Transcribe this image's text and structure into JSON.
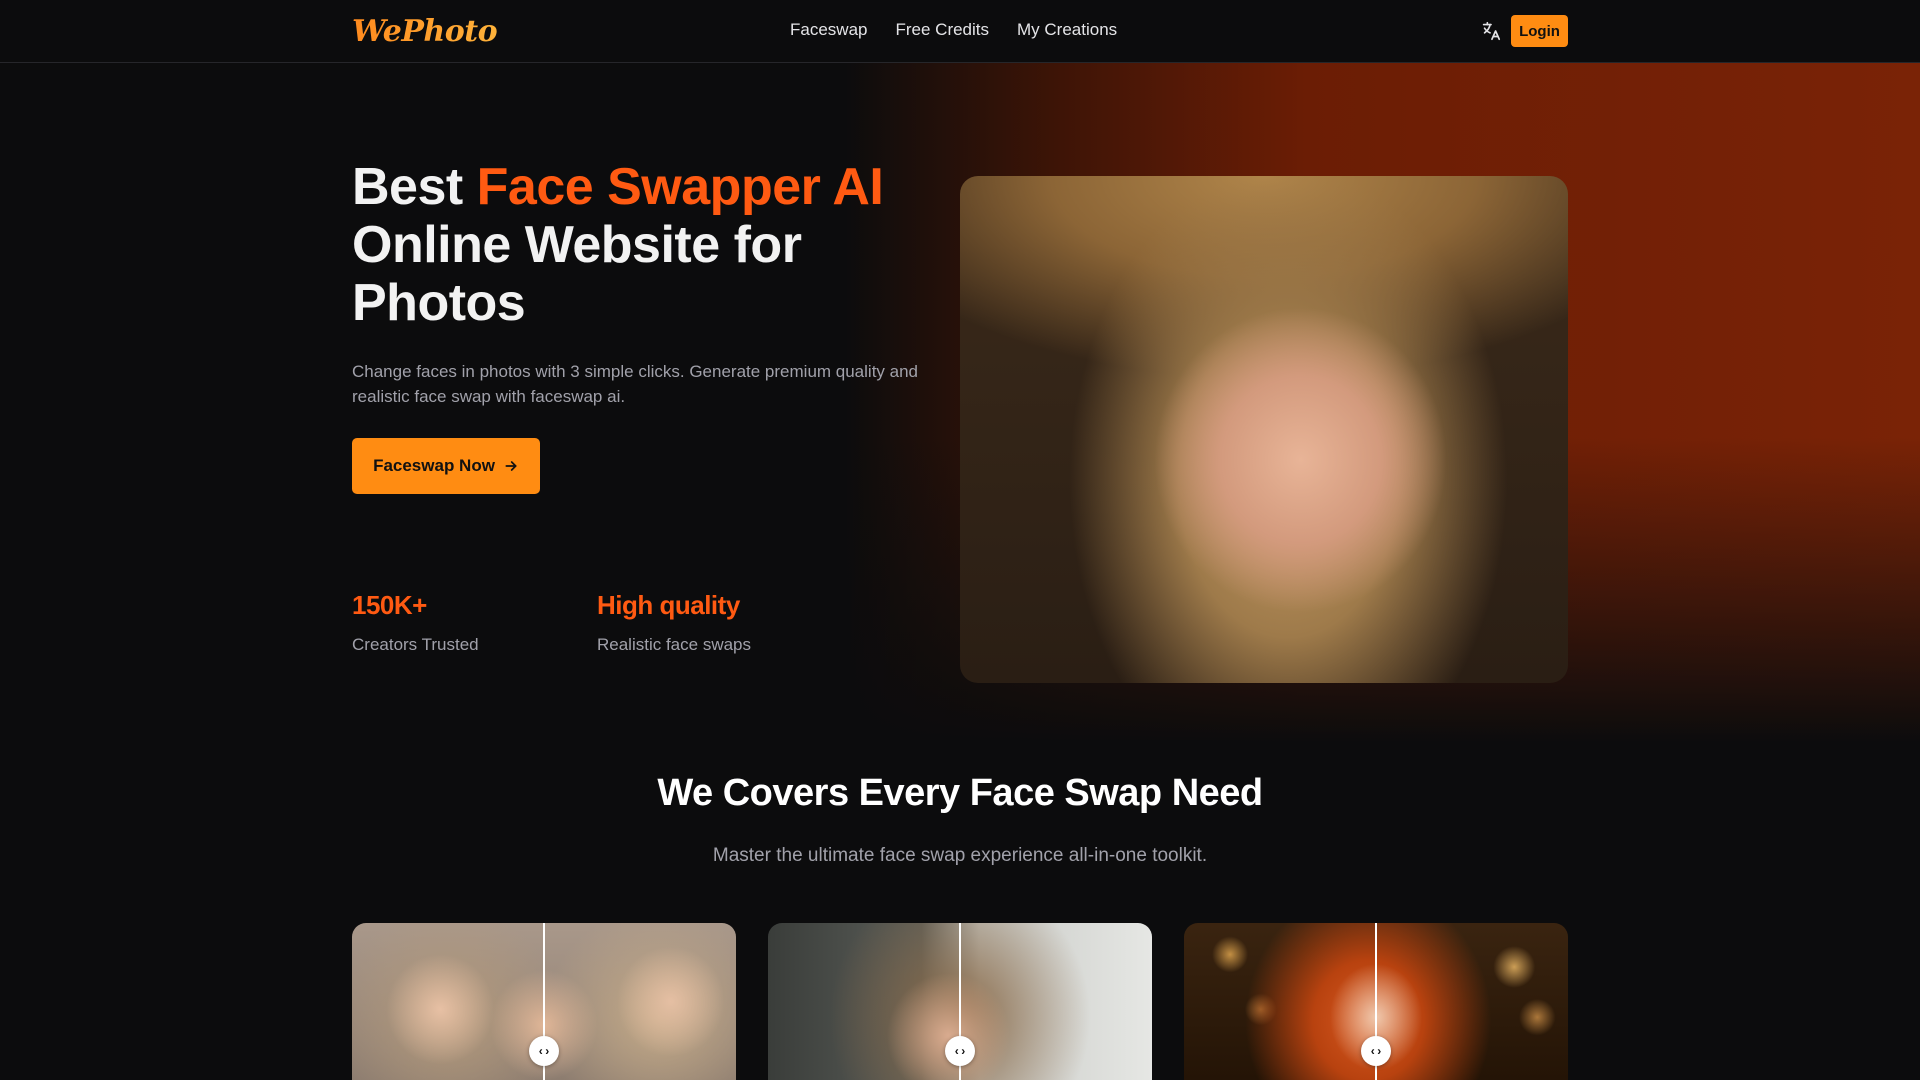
{
  "brand": {
    "logo_text": "WePhoto"
  },
  "nav": {
    "items": [
      "Faceswap",
      "Free Credits",
      "My Creations"
    ]
  },
  "header": {
    "login_label": "Login",
    "translate_icon": "translate-icon"
  },
  "hero": {
    "title_prefix": "Best ",
    "title_accent": "Face Swapper AI",
    "title_suffix": "Online Website for Photos",
    "description": "Change faces in photos with 3 simple clicks. Generate premium quality and realistic face swap with faceswap ai.",
    "cta_label": "Faceswap Now",
    "stats": [
      {
        "value": "150K+",
        "label": "Creators Trusted"
      },
      {
        "value": "High quality",
        "label": "Realistic face swaps"
      }
    ]
  },
  "features": {
    "title": "We Covers Every Face Swap Need",
    "subtitle": "Master the ultimate face swap experience all-in-one toolkit.",
    "cards": [
      {
        "handle_icon": "compare-slider-icon"
      },
      {
        "handle_icon": "compare-slider-icon"
      },
      {
        "handle_icon": "compare-slider-icon"
      }
    ]
  },
  "colors": {
    "accent_orange": "#ff8c12",
    "accent_red_orange": "#ff5a12",
    "background": "#0c0c0d",
    "muted_text": "#a1a1aa"
  }
}
